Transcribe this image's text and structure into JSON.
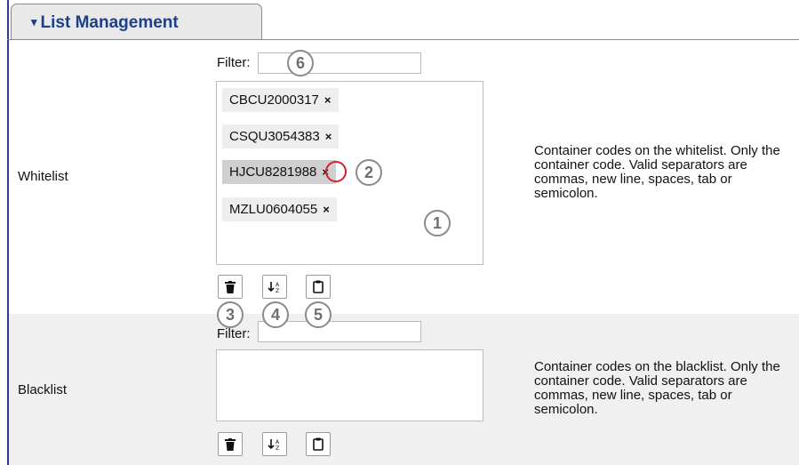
{
  "section": {
    "title": "List Management",
    "caret": "▾"
  },
  "whitelist": {
    "label": "Whitelist",
    "filter_label": "Filter:",
    "filter_value": "",
    "items": [
      "CBCU2000317",
      "CSQU3054383",
      "HJCU8281988",
      "MZLU0604055"
    ],
    "selected_item": "HJCU8281988",
    "remove_glyph": "×",
    "description": "Container codes on the whitelist. Only the container code. Valid separators are commas, new line, spaces, tab or semicolon."
  },
  "blacklist": {
    "label": "Blacklist",
    "filter_label": "Filter:",
    "filter_value": "",
    "items": [],
    "description": "Container codes on the blacklist. Only the container code. Valid separators are commas, new line, spaces, tab or semicolon."
  },
  "toolbar_icons": [
    "trash-icon",
    "sort-icon",
    "clipboard-icon"
  ],
  "callouts": {
    "list": "1",
    "remove_item": "2",
    "clear_all": "3",
    "sort": "4",
    "paste": "5",
    "filter": "6"
  },
  "colors": {
    "accent": "#1d3f86",
    "rule": "#2b3f8f",
    "highlight_ring": "#d2232a",
    "selected_chip": "#cfcfcf",
    "chip": "#eeeeee"
  }
}
